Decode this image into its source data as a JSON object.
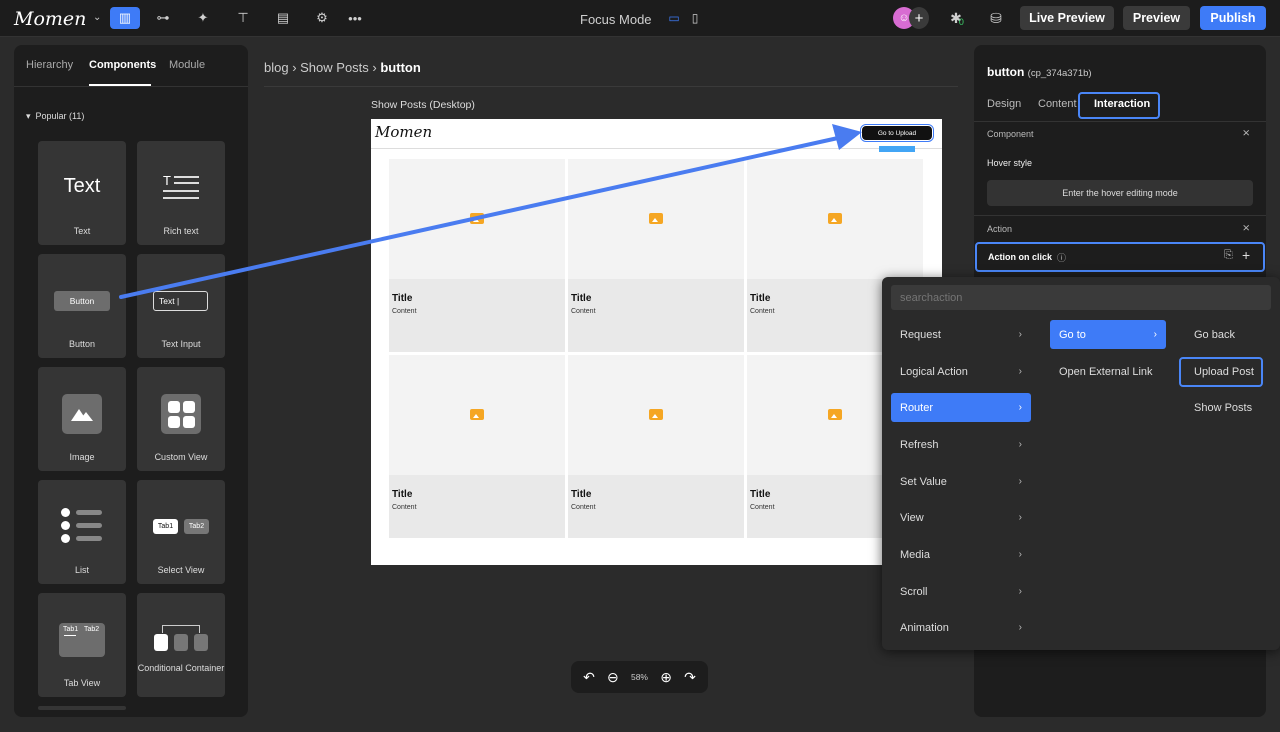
{
  "topbar": {
    "logo": "Momen",
    "focus_mode": "Focus Mode",
    "live_preview": "Live Preview",
    "preview": "Preview",
    "publish": "Publish",
    "notification_count": "0"
  },
  "left_panel": {
    "tabs": [
      "Hierarchy",
      "Components",
      "Module"
    ],
    "active_tab": "Components",
    "section": "Popular (11)",
    "components": [
      {
        "label": "Text",
        "preview": "Text"
      },
      {
        "label": "Rich text"
      },
      {
        "label": "Button",
        "preview": "Button"
      },
      {
        "label": "Text Input",
        "preview": "Text |"
      },
      {
        "label": "Image"
      },
      {
        "label": "Custom View"
      },
      {
        "label": "List"
      },
      {
        "label": "Select View",
        "preview_tabs": [
          "Tab1",
          "Tab2"
        ]
      },
      {
        "label": "Tab View",
        "preview_tabs": [
          "Tab1",
          "Tab2"
        ]
      },
      {
        "label": "Conditional Container"
      }
    ]
  },
  "canvas": {
    "breadcrumb": [
      "blog",
      "Show Posts",
      "button"
    ],
    "frame_title": "Show Posts (Desktop)",
    "frame_logo": "Momen",
    "goto_button": "Go to Upload",
    "cards": [
      {
        "title": "Title",
        "content": "Content"
      },
      {
        "title": "Title",
        "content": "Content"
      },
      {
        "title": "Title",
        "content": "Content"
      },
      {
        "title": "Title",
        "content": "Content"
      },
      {
        "title": "Title",
        "content": "Content"
      },
      {
        "title": "Title",
        "content": "Content"
      }
    ],
    "zoom": "58%"
  },
  "right_panel": {
    "title": "button",
    "id": "(cp_374a371b)",
    "tabs": [
      "Design",
      "Content",
      "Interaction"
    ],
    "active_tab": "Interaction",
    "component_section": "Component",
    "hover_style": "Hover style",
    "hover_button": "Enter the hover editing mode",
    "action_section": "Action",
    "action_on_click": "Action on click"
  },
  "menu": {
    "search_placeholder": "searchaction",
    "col1": [
      "Request",
      "Logical Action",
      "Router",
      "Refresh",
      "Set Value",
      "View",
      "Media",
      "Scroll",
      "Animation"
    ],
    "col1_active": "Router",
    "col2": [
      "Go to",
      "Open External Link"
    ],
    "col2_active": "Go to",
    "col3": [
      "Go back",
      "Upload Post",
      "Show Posts"
    ],
    "col3_highlight": "Upload Post"
  },
  "colors": {
    "accent": "#3e7bf7",
    "highlight_border": "#4a86f7",
    "image_icon": "#f5a623"
  }
}
